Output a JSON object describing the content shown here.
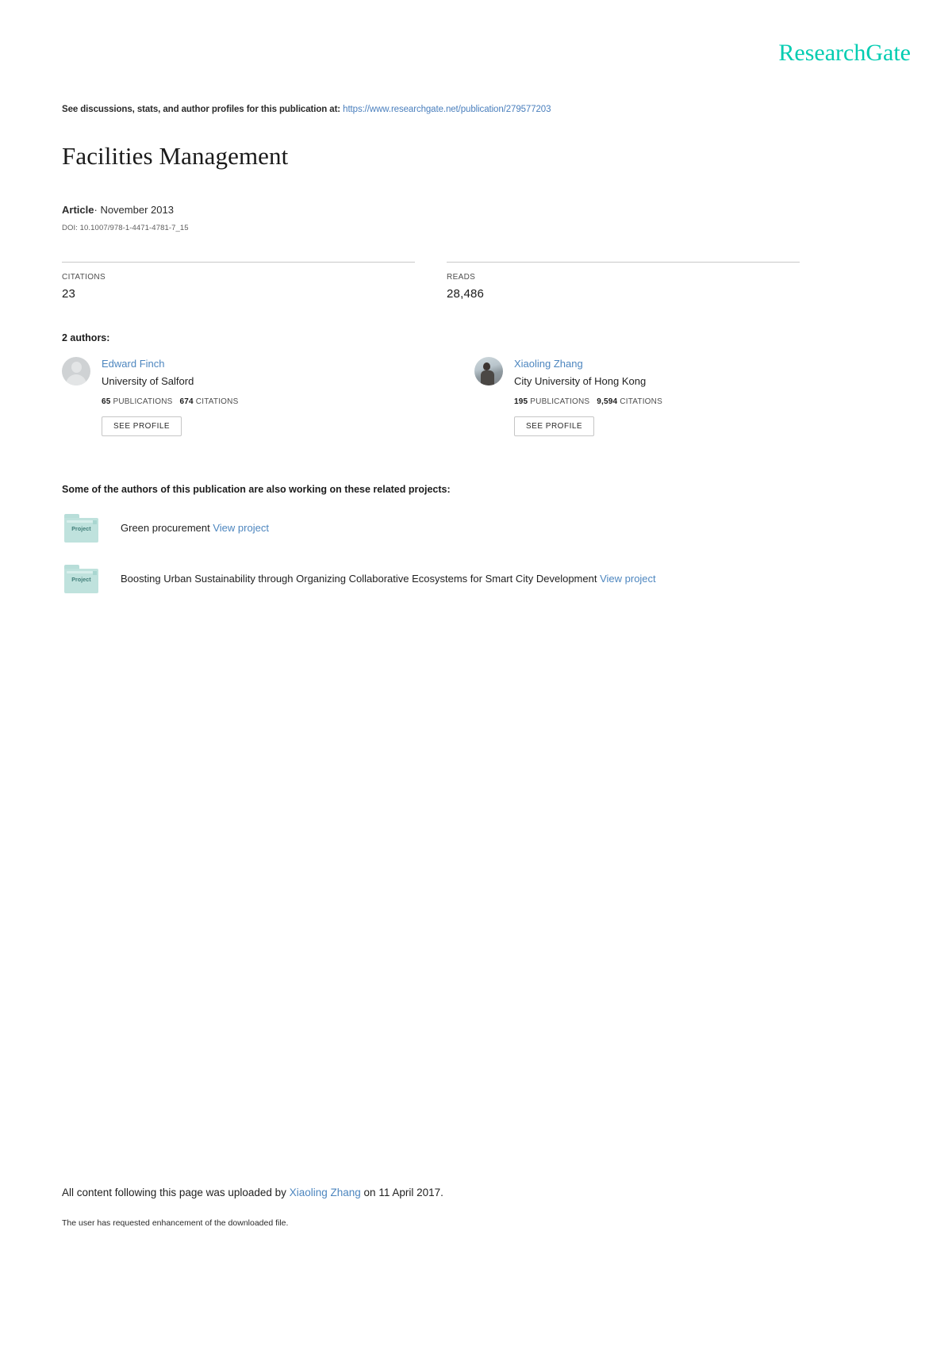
{
  "brand": {
    "name": "ResearchGate",
    "color": "#00ccb1"
  },
  "header": {
    "discussion_prefix": "See discussions, stats, and author profiles for this publication at:",
    "publication_url": "https://www.researchgate.net/publication/279577203"
  },
  "publication": {
    "title": "Facilities Management",
    "type": "Article",
    "type_separator": "·",
    "date": "November 2013",
    "doi": "DOI: 10.1007/978-1-4471-4781-7_15"
  },
  "stats": [
    {
      "label": "CITATIONS",
      "value": "23"
    },
    {
      "label": "READS",
      "value": "28,486"
    }
  ],
  "authors_section": {
    "heading": "2 authors:",
    "see_profile_label": "SEE PROFILE",
    "publications_label": "PUBLICATIONS",
    "citations_label": "CITATIONS",
    "authors": [
      {
        "name": "Edward Finch",
        "affiliation": "University of Salford",
        "publications": "65",
        "citations": "674",
        "avatar": "placeholder-avatar-icon"
      },
      {
        "name": "Xiaoling Zhang",
        "affiliation": "City University of Hong Kong",
        "publications": "195",
        "citations": "9,594",
        "avatar": "photo-avatar"
      }
    ]
  },
  "projects_section": {
    "heading": "Some of the authors of this publication are also working on these related projects:",
    "folder_label": "Project",
    "view_project_label": "View project",
    "projects": [
      {
        "title": "Green procurement"
      },
      {
        "title": "Boosting Urban Sustainability through Organizing Collaborative Ecosystems for Smart City Development"
      }
    ]
  },
  "footer": {
    "upload_prefix": "All content following this page was uploaded by",
    "uploader": "Xiaoling Zhang",
    "upload_suffix": "on 11 April 2017.",
    "note": "The user has requested enhancement of the downloaded file."
  }
}
